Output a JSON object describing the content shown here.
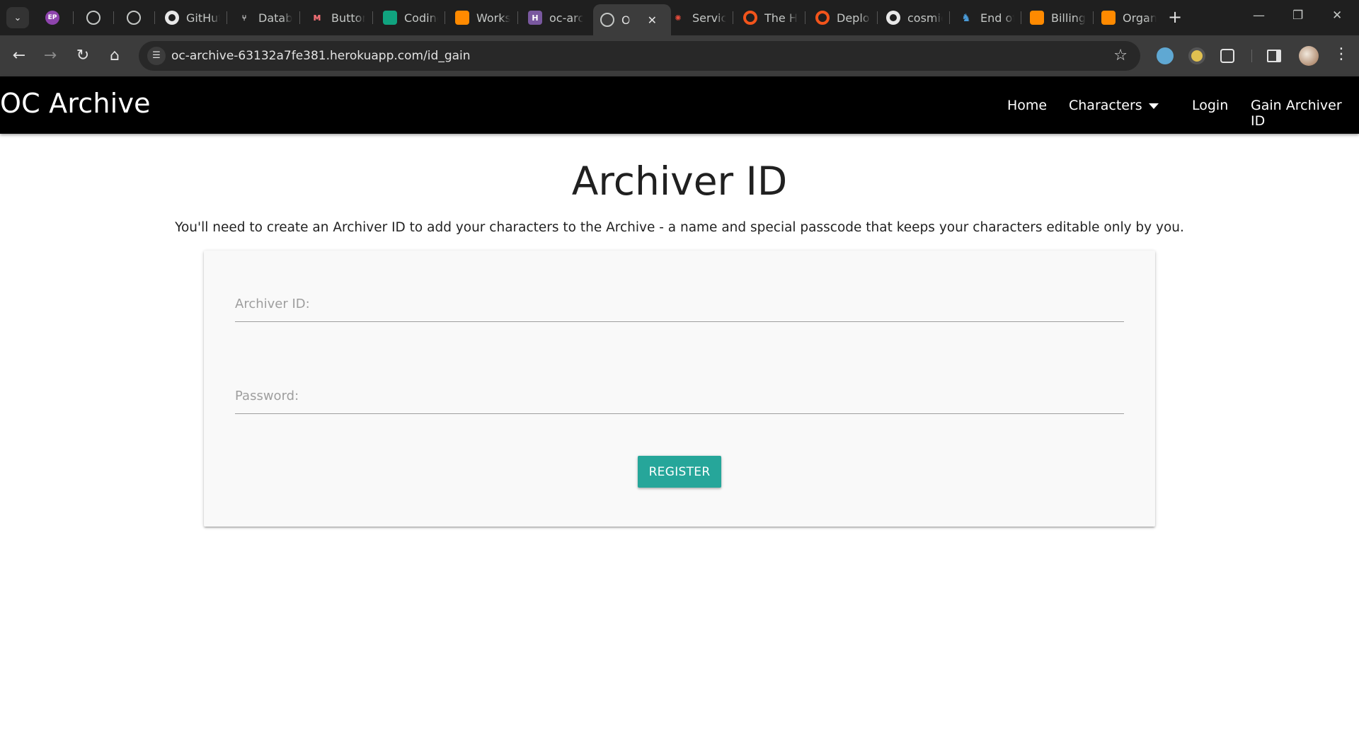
{
  "browser": {
    "tabs": [
      {
        "label": "",
        "icon": "profile-ep-icon"
      },
      {
        "label": "",
        "icon": "globe-icon"
      },
      {
        "label": "",
        "icon": "globe-icon"
      },
      {
        "label": "GitHub",
        "icon": "github-icon"
      },
      {
        "label": "Database",
        "icon": "git-icon"
      },
      {
        "label": "Buttons",
        "icon": "materialize-icon"
      },
      {
        "label": "Coding",
        "icon": "chatgpt-icon"
      },
      {
        "label": "Workspace",
        "icon": "gitpod-icon"
      },
      {
        "label": "oc-archive",
        "icon": "heroku-icon"
      },
      {
        "label": "OC Archive",
        "icon": "globe-icon",
        "active": true
      },
      {
        "label": "Services",
        "icon": "crab-icon"
      },
      {
        "label": "The Heroku",
        "icon": "orange-ring-icon"
      },
      {
        "label": "Deploy",
        "icon": "orange-ring-icon"
      },
      {
        "label": "cosmic",
        "icon": "github-icon"
      },
      {
        "label": "End of",
        "icon": "elephant-icon"
      },
      {
        "label": "Billing",
        "icon": "gitpod-icon"
      },
      {
        "label": "Organ",
        "icon": "gitpod-icon"
      }
    ],
    "tabs_visible": [
      "",
      "",
      "",
      "GitHut",
      "Databa",
      "Button",
      "Coding",
      "Works",
      "oc-arc",
      "O",
      "Servic",
      "The H",
      "Deploy",
      "cosmic",
      "End of",
      "Billing",
      "Organ"
    ],
    "new_tab": "+",
    "url": "oc-archive-63132a7fe381.herokuapp.com/id_gain"
  },
  "site": {
    "brand": "OC Archive",
    "nav": {
      "home": "Home",
      "characters": "Characters",
      "login": "Login",
      "gain_id": "Gain Archiver ID"
    }
  },
  "page": {
    "title": "Archiver ID",
    "intro": "You'll need to create an Archiver ID to add your characters to the Archive - a name and special passcode that keeps your characters editable only by you.",
    "form": {
      "archiver_id_placeholder": "Archiver ID:",
      "archiver_id_value": "",
      "password_placeholder": "Password:",
      "password_value": "",
      "submit_label": "REGISTER"
    }
  },
  "colors": {
    "navbar": "#000000",
    "button": "#26a69a",
    "card": "#f9f9f9"
  }
}
